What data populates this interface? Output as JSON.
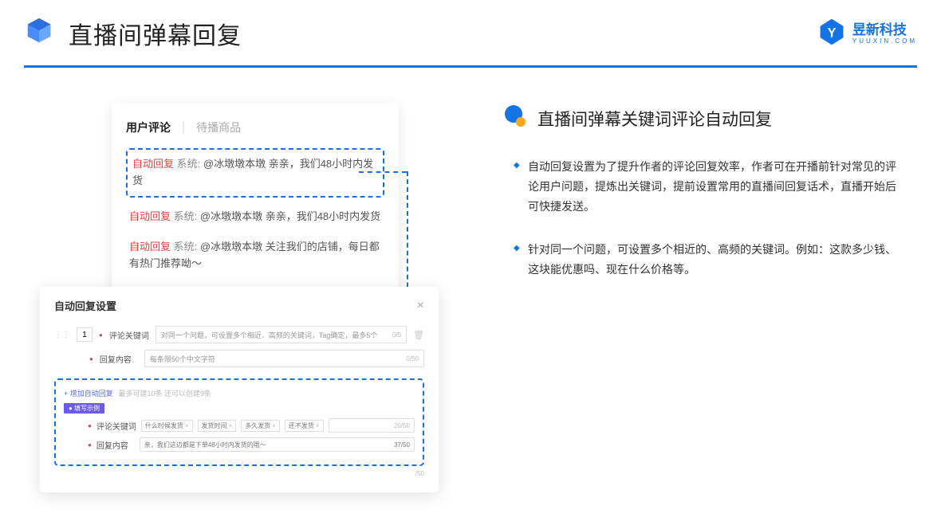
{
  "header": {
    "title": "直播间弹幕回复",
    "brand_name": "昱新科技",
    "brand_url": "YUUXIN.COM"
  },
  "comment_card": {
    "tab_active": "用户评论",
    "tab_inactive": "待播商品",
    "rows": [
      {
        "tag": "自动回复",
        "sys": "系统:",
        "text": "@冰墩墩本墩 亲亲，我们48小时内发货"
      },
      {
        "tag": "自动回复",
        "sys": "系统:",
        "text": "@冰墩墩本墩 亲亲，我们48小时内发货"
      },
      {
        "tag": "自动回复",
        "sys": "系统:",
        "text": "@冰墩墩本墩 关注我们的店铺，每日都有热门推荐呦～"
      }
    ]
  },
  "modal": {
    "title": "自动回复设置",
    "idx": "1",
    "keyword_label": "评论关键词",
    "keyword_placeholder": "对同一个问题，可设置多个相近、高频的关键词，Tag确定，最多5个",
    "keyword_counter": "0/5",
    "content_label": "回复内容",
    "content_placeholder": "每条限50个中文字符",
    "content_counter": "0/50",
    "add_link": "+ 增加自动回复",
    "add_hint": "最多可建10条 还可以创建9条",
    "example_tag": "● 填写示例",
    "ex_keyword_label": "评论关键词",
    "ex_tags": [
      "什么时候发货",
      "发货时间",
      "多久发货",
      "还不发货"
    ],
    "ex_tag_counter": "20/50",
    "ex_content_label": "回复内容",
    "ex_content_text": "亲，我们这边都是下单48小时内发货的哦～",
    "ex_content_counter": "37/50",
    "extra_counter": "/50"
  },
  "right": {
    "section_title": "直播间弹幕关键词评论自动回复",
    "bullets": [
      "自动回复设置为了提升作者的评论回复效率，作者可在开播前针对常见的评论用户问题，提炼出关键词，提前设置常用的直播间回复话术，直播开始后可快捷发送。",
      "针对同一个问题，可设置多个相近的、高频的关键词。例如：这款多少钱、这块能优惠吗、现在什么价格等。"
    ]
  }
}
